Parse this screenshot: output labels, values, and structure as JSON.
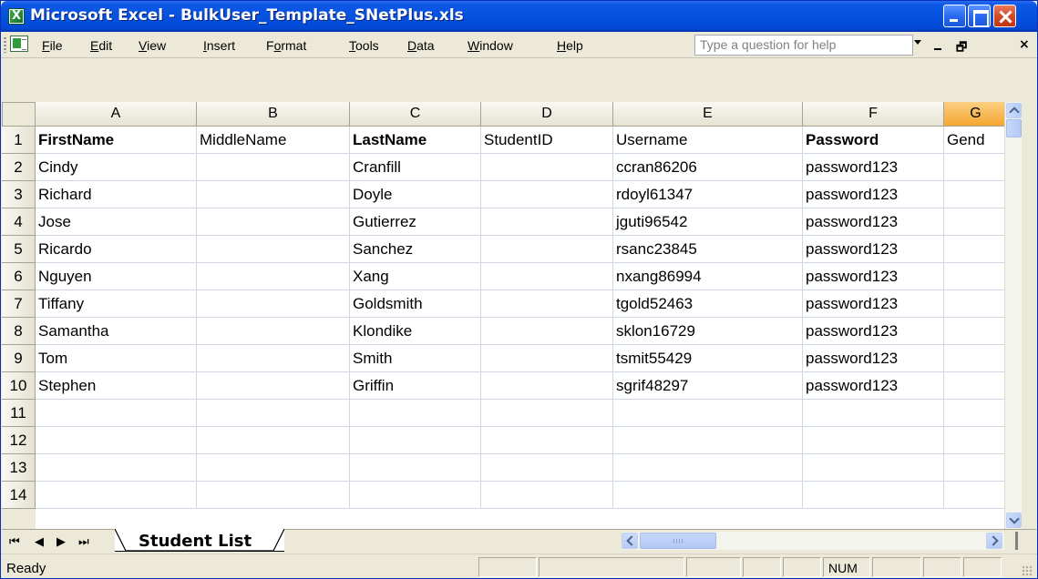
{
  "window": {
    "title": "Microsoft Excel - BulkUser_Template_SNetPlus.xls"
  },
  "menu": [
    {
      "label": "File",
      "u": "F"
    },
    {
      "label": "Edit",
      "u": "E"
    },
    {
      "label": "View",
      "u": "V"
    },
    {
      "label": "Insert",
      "u": "I"
    },
    {
      "label": "Format",
      "u": "o"
    },
    {
      "label": "Tools",
      "u": "T"
    },
    {
      "label": "Data",
      "u": "D"
    },
    {
      "label": "Window",
      "u": "W"
    },
    {
      "label": "Help",
      "u": "H"
    }
  ],
  "help": {
    "placeholder": "Type a question for help"
  },
  "columns": [
    "A",
    "B",
    "C",
    "D",
    "E",
    "F",
    "G"
  ],
  "selected_column": "G",
  "row_numbers": [
    "1",
    "2",
    "3",
    "4",
    "5",
    "6",
    "7",
    "8",
    "9",
    "10",
    "11",
    "12",
    "13",
    "14"
  ],
  "header_row": {
    "FirstName": "FirstName",
    "MiddleName": "MiddleName",
    "LastName": "LastName",
    "StudentID": "StudentID",
    "Username": "Username",
    "Password": "Password",
    "Gender": "Gend"
  },
  "bold_headers": [
    "FirstName",
    "LastName",
    "Password"
  ],
  "rows": [
    [
      "Cindy",
      "",
      "Cranfill",
      "",
      "ccran86206",
      "password123",
      ""
    ],
    [
      "Richard",
      "",
      "Doyle",
      "",
      "rdoyl61347",
      "password123",
      ""
    ],
    [
      "Jose",
      "",
      "Gutierrez",
      "",
      "jguti96542",
      "password123",
      ""
    ],
    [
      "Ricardo",
      "",
      "Sanchez",
      "",
      "rsanc23845",
      "password123",
      ""
    ],
    [
      "Nguyen",
      "",
      "Xang",
      "",
      "nxang86994",
      "password123",
      ""
    ],
    [
      "Tiffany",
      "",
      "Goldsmith",
      "",
      "tgold52463",
      "password123",
      ""
    ],
    [
      "Samantha",
      "",
      "Klondike",
      "",
      "sklon16729",
      "password123",
      ""
    ],
    [
      "Tom",
      "",
      "Smith",
      "",
      "tsmit55429",
      "password123",
      ""
    ],
    [
      "Stephen",
      "",
      "Griffin",
      "",
      "sgrif48297",
      "password123",
      ""
    ]
  ],
  "sheet_tab": "Student List",
  "status": {
    "text": "Ready",
    "num": "NUM"
  },
  "colors": {
    "titlebar": "#0552df",
    "selected_column_header": "#f4a631",
    "gridline": "#d0d7e5"
  }
}
